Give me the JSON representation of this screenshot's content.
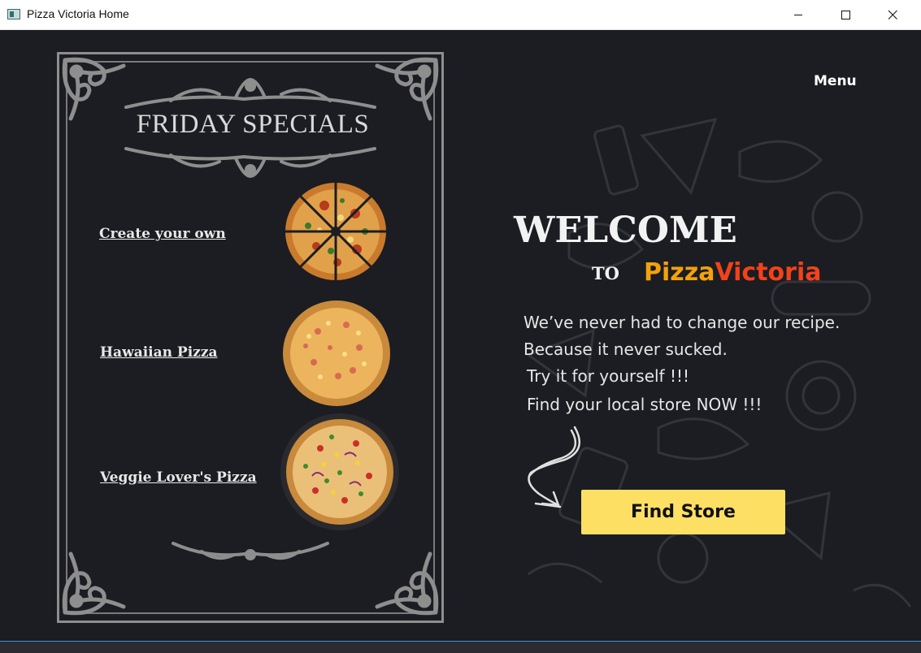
{
  "window": {
    "title": "Pizza Victoria Home",
    "icon": "app-window-icon",
    "controls": [
      "minimize-icon",
      "maximize-icon",
      "close-icon"
    ]
  },
  "colors": {
    "background": "#1b1d22",
    "frame": "#8e8e8e",
    "brand_pizza": "#f2a20c",
    "brand_victoria": "#f2421a",
    "button": "#fde063"
  },
  "specials": {
    "title": "FRIDAY SPECIALS",
    "items": [
      {
        "label": "Create your own",
        "image": "sliced-mixed-pizza"
      },
      {
        "label": "Hawaiian Pizza",
        "image": "hawaiian-pizza"
      },
      {
        "label": "Veggie Lover's Pizza",
        "image": "veggie-pizza"
      }
    ]
  },
  "nav": {
    "menu_label": "Menu"
  },
  "hero": {
    "welcome": "WELCOME",
    "to": "TO",
    "brand_part1": "Pizza",
    "brand_part2": "Victoria",
    "taglines": [
      "We’ve never had to change our recipe.",
      "Because it never sucked.",
      "Try it for yourself !!!",
      "Find your local store NOW !!!"
    ],
    "cta_label": "Find Store"
  }
}
